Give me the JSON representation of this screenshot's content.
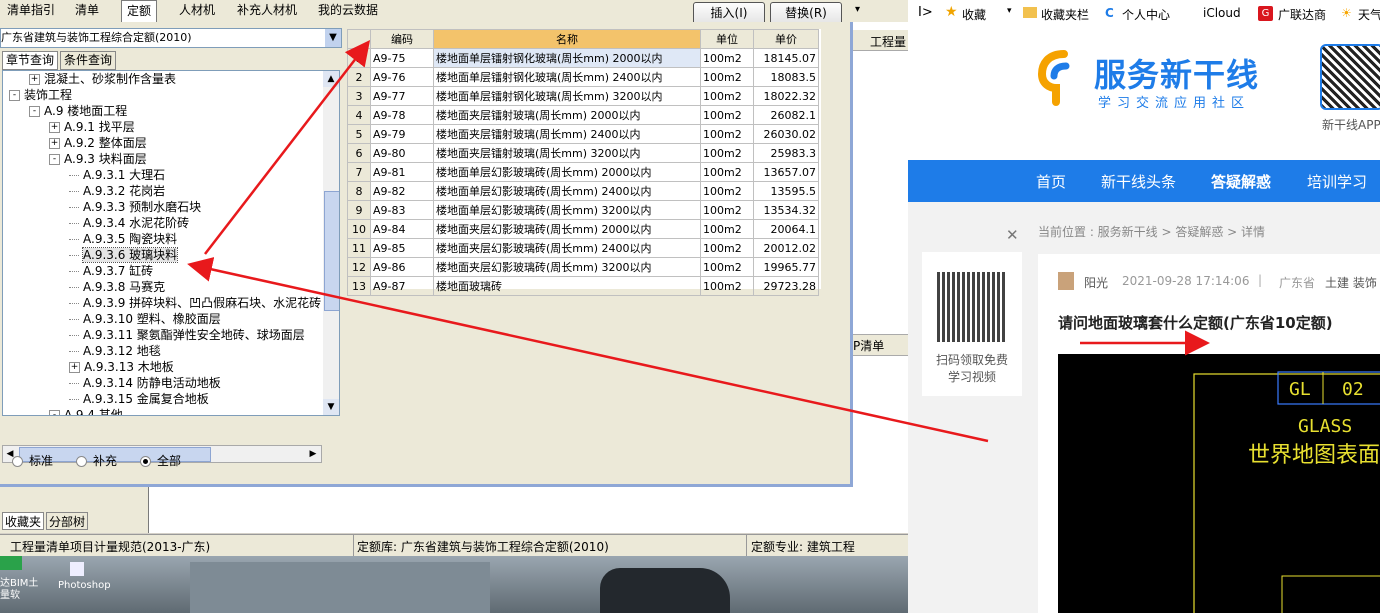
{
  "app": {
    "top_tabs": [
      "清单指引",
      "清单",
      "定额",
      "人材机",
      "补充人材机",
      "我的云数据"
    ],
    "active_tab": "定额",
    "insert_button": "插入(I)",
    "replace_button": "替换(R)",
    "close_glyph": "▾",
    "behind_header": "工程量",
    "library_combo": "广东省建筑与装饰工程综合定额(2010)",
    "sub_tabs": [
      "章节查询",
      "条件查询"
    ],
    "tree": [
      {
        "label": "混凝土、砂浆制作含量表",
        "level": 2,
        "expander": "+"
      },
      {
        "label": "装饰工程",
        "level": 1,
        "expander": "-"
      },
      {
        "label": "A.9 楼地面工程",
        "level": 2,
        "expander": "-"
      },
      {
        "label": "A.9.1 找平层",
        "level": 3,
        "expander": "+"
      },
      {
        "label": "A.9.2 整体面层",
        "level": 3,
        "expander": "+"
      },
      {
        "label": "A.9.3 块料面层",
        "level": 3,
        "expander": "-"
      },
      {
        "label": "A.9.3.1 大理石",
        "level": 4,
        "expander": ""
      },
      {
        "label": "A.9.3.2 花岗岩",
        "level": 4,
        "expander": ""
      },
      {
        "label": "A.9.3.3 预制水磨石块",
        "level": 4,
        "expander": ""
      },
      {
        "label": "A.9.3.4 水泥花阶砖",
        "level": 4,
        "expander": ""
      },
      {
        "label": "A.9.3.5 陶瓷块料",
        "level": 4,
        "expander": ""
      },
      {
        "label": "A.9.3.6 玻璃块料",
        "level": 4,
        "expander": "",
        "selected": true
      },
      {
        "label": "A.9.3.7 缸砖",
        "level": 4,
        "expander": ""
      },
      {
        "label": "A.9.3.8 马赛克",
        "level": 4,
        "expander": ""
      },
      {
        "label": "A.9.3.9 拼碎块料、凹凸假麻石块、水泥花砖",
        "level": 4,
        "expander": ""
      },
      {
        "label": "A.9.3.10 塑料、橡胶面层",
        "level": 4,
        "expander": ""
      },
      {
        "label": "A.9.3.11 聚氨酯弹性安全地砖、球场面层",
        "level": 4,
        "expander": ""
      },
      {
        "label": "A.9.3.12 地毯",
        "level": 4,
        "expander": ""
      },
      {
        "label": "A.9.3.13 木地板",
        "level": 4,
        "expander": "+"
      },
      {
        "label": "A.9.3.14 防静电活动地板",
        "level": 4,
        "expander": ""
      },
      {
        "label": "A.9.3.15 金属复合地板",
        "level": 4,
        "expander": ""
      },
      {
        "label": "A.9.4 其他",
        "level": 3,
        "expander": "-"
      }
    ],
    "radios": [
      {
        "label": "标准",
        "checked": false
      },
      {
        "label": "补充",
        "checked": false
      },
      {
        "label": "全部",
        "checked": true
      }
    ],
    "grid": {
      "headers": [
        "编码",
        "名称",
        "单位",
        "单价"
      ],
      "rows": [
        {
          "no": "1",
          "code": "A9-75",
          "name": "楼地面单层镭射钢化玻璃(周长mm) 2000以内",
          "unit": "100m2",
          "price": "18145.07"
        },
        {
          "no": "2",
          "code": "A9-76",
          "name": "楼地面单层镭射钢化玻璃(周长mm) 2400以内",
          "unit": "100m2",
          "price": "18083.5"
        },
        {
          "no": "3",
          "code": "A9-77",
          "name": "楼地面单层镭射钢化玻璃(周长mm) 3200以内",
          "unit": "100m2",
          "price": "18022.32"
        },
        {
          "no": "4",
          "code": "A9-78",
          "name": "楼地面夹层镭射玻璃(周长mm) 2000以内",
          "unit": "100m2",
          "price": "26082.1"
        },
        {
          "no": "5",
          "code": "A9-79",
          "name": "楼地面夹层镭射玻璃(周长mm) 2400以内",
          "unit": "100m2",
          "price": "26030.02"
        },
        {
          "no": "6",
          "code": "A9-80",
          "name": "楼地面夹层镭射玻璃(周长mm) 3200以内",
          "unit": "100m2",
          "price": "25983.3"
        },
        {
          "no": "7",
          "code": "A9-81",
          "name": "楼地面单层幻影玻璃砖(周长mm) 2000以内",
          "unit": "100m2",
          "price": "13657.07"
        },
        {
          "no": "8",
          "code": "A9-82",
          "name": "楼地面单层幻影玻璃砖(周长mm) 2400以内",
          "unit": "100m2",
          "price": "13595.5"
        },
        {
          "no": "9",
          "code": "A9-83",
          "name": "楼地面单层幻影玻璃砖(周长mm) 3200以内",
          "unit": "100m2",
          "price": "13534.32"
        },
        {
          "no": "10",
          "code": "A9-84",
          "name": "楼地面夹层幻影玻璃砖(周长mm) 2000以内",
          "unit": "100m2",
          "price": "20064.1"
        },
        {
          "no": "11",
          "code": "A9-85",
          "name": "楼地面夹层幻影玻璃砖(周长mm) 2400以内",
          "unit": "100m2",
          "price": "20012.02"
        },
        {
          "no": "12",
          "code": "A9-86",
          "name": "楼地面夹层幻影玻璃砖(周长mm) 3200以内",
          "unit": "100m2",
          "price": "19965.77"
        },
        {
          "no": "13",
          "code": "A9-87",
          "name": "楼地面玻璃砖",
          "unit": "100m2",
          "price": "29723.28"
        }
      ]
    },
    "behind_labels": [
      "P清单"
    ],
    "bottom_tabs": [
      "收藏夹",
      "分部树"
    ],
    "status": {
      "spec": "工程量清单项目计量规范(2013-广东)",
      "library": "定额库: 广东省建筑与装饰工程综合定额(2010)",
      "major": "定额专业: 建筑工程"
    },
    "desktop_icons": [
      "达BIM土\n量软",
      "Photoshop"
    ]
  },
  "browser": {
    "bookmarks": [
      "收藏",
      "收藏夹栏",
      "个人中心",
      "iCloud",
      "广联达商",
      "天气"
    ],
    "site_name": "服务新干线",
    "site_tagline": "学习交流应用社区",
    "app_label": "新干线APP",
    "nav": [
      "首页",
      "新干线头条",
      "答疑解惑",
      "培训学习"
    ],
    "active_nav": "答疑解惑",
    "breadcrumb": "当前位置 : 服务新干线 > 答疑解惑 > 详情",
    "qr_caption": "扫码领取免费学习视频",
    "close_glyph": "✕",
    "author": "阳光",
    "date": "2021-09-28 17:14:06",
    "region": "广东省",
    "tags": "土建 装饰",
    "article_title": "请问地面玻璃套什么定额(广东省10定额)",
    "cad": {
      "label_gl": "GL",
      "label_02": "02",
      "glass": "GLASS",
      "caption": "世界地图表面压"
    },
    "colors": {
      "nav": "#1e7ce8",
      "arrow": "#e8191c",
      "cad_yellow": "#e8e030",
      "cad_blue": "#3a7cff"
    }
  }
}
